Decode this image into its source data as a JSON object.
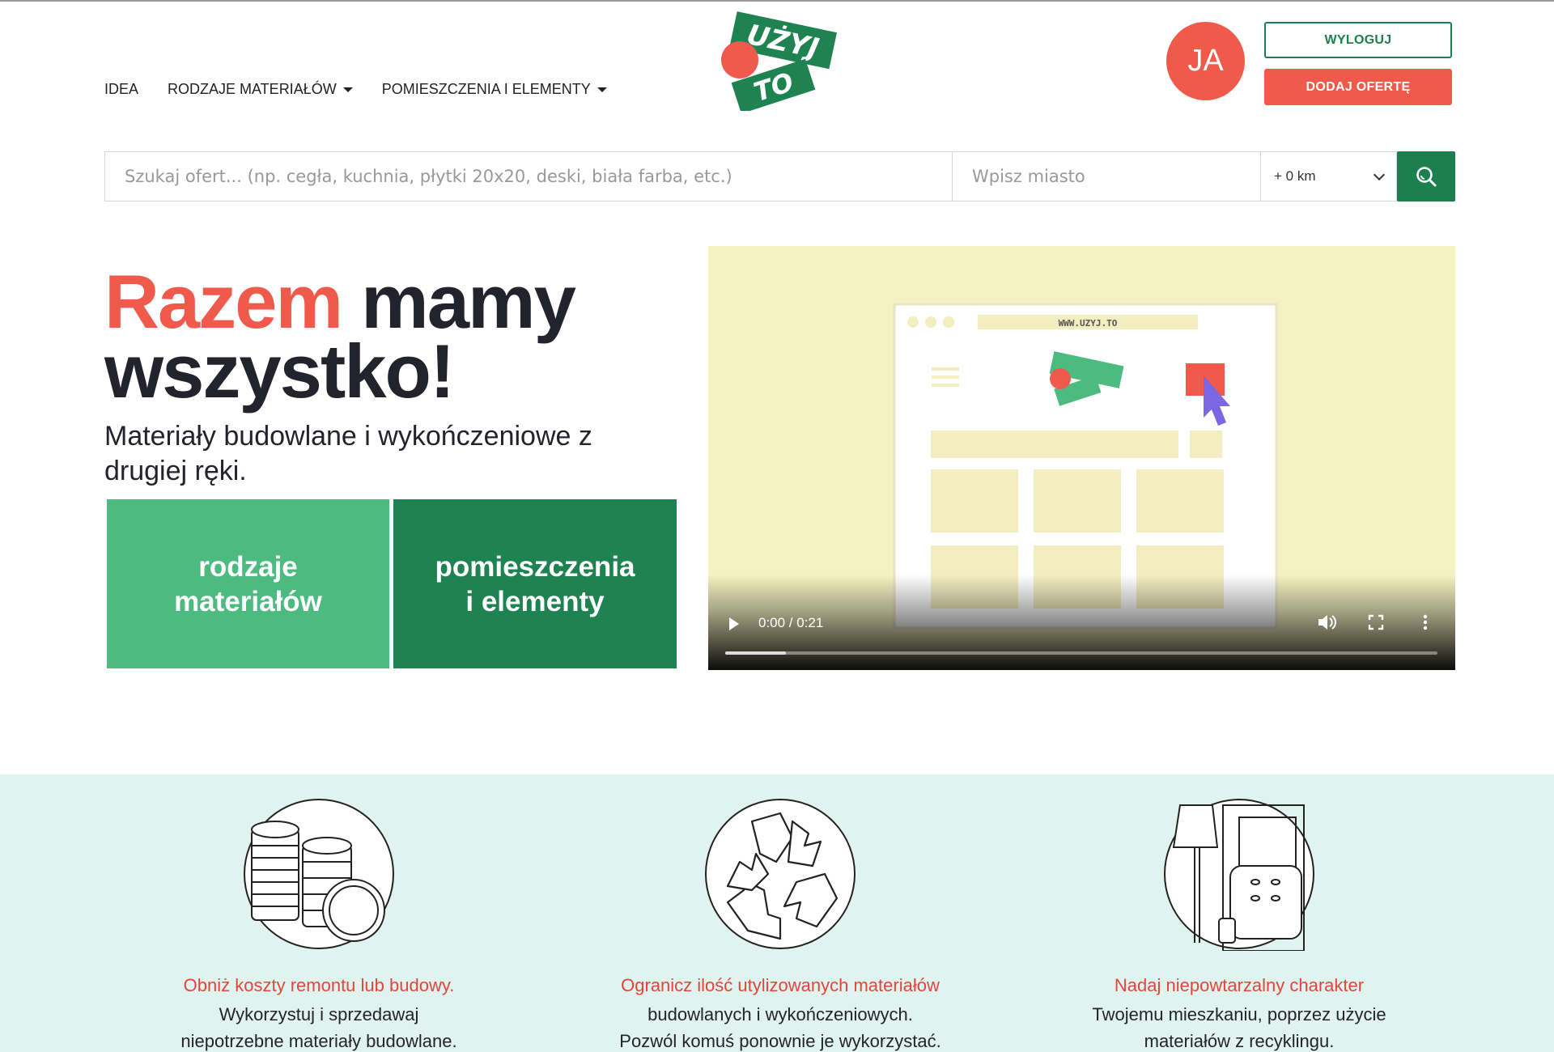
{
  "header": {
    "nav": [
      {
        "label": "IDEA",
        "has_dropdown": false
      },
      {
        "label": "RODZAJE MATERIAŁÓW",
        "has_dropdown": true
      },
      {
        "label": "POMIESZCZENIA I ELEMENTY",
        "has_dropdown": true
      }
    ],
    "logo": {
      "line1": "UŻYJ",
      "line2": "TO"
    },
    "avatar_initials": "JA",
    "logout_label": "WYLOGUJ",
    "add_offer_label": "DODAJ OFERTĘ"
  },
  "search": {
    "query_placeholder": "Szukaj ofert... (np. cegła, kuchnia, płytki 20x20, deski, biała farba, etc.)",
    "city_placeholder": "Wpisz miasto",
    "distance_selected": "+ 0 km",
    "search_icon": "search-icon"
  },
  "hero": {
    "title_accent": "Razem",
    "title_rest_1": "mamy",
    "title_rest_2": "wszystko!",
    "subtitle": "Materiały budowlane i wykończeniowe z drugiej ręki.",
    "tiles": [
      {
        "line1": "rodzaje",
        "line2": "materiałów"
      },
      {
        "line1": "pomieszczenia",
        "line2": "i elementy"
      }
    ]
  },
  "video": {
    "url_text": "WWW.UZYJ.TO",
    "time": "0:00 / 0:21",
    "progress": 0.085
  },
  "features": [
    {
      "title": "Obniż koszty remontu lub budowy.",
      "line1": "Wykorzystuj i sprzedawaj",
      "line2": "niepotrzebne materiały budowlane.",
      "icon": "coins-icon"
    },
    {
      "title": "Ogranicz ilość utylizowanych materiałów",
      "line1": "budowlanych i wykończeniowych.",
      "line2": "Pozwól komuś ponownie je wykorzystać.",
      "icon": "recycle-icon"
    },
    {
      "title": "Nadaj niepowtarzalny charakter",
      "line1": "Twojemu mieszkaniu, poprzez użycie",
      "line2": "materiałów z recyklingu.",
      "icon": "furniture-icon"
    }
  ],
  "colors": {
    "accent_red": "#f05a4b",
    "brand_green": "#1d7f4e",
    "light_green": "#4dba7f",
    "features_bg": "#e1f3ef",
    "video_bg": "#f5f2c2"
  }
}
